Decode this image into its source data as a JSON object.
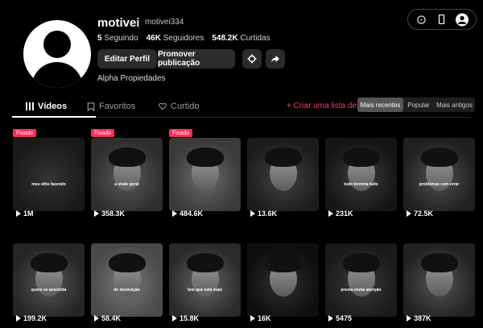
{
  "profile": {
    "username": "motivei",
    "handle": "motivei334",
    "stats": [
      {
        "value": "5",
        "label": "Seguindo"
      },
      {
        "value": "46K",
        "label": "Seguidores"
      },
      {
        "value": "548.2K",
        "label": "Curtidas"
      }
    ],
    "edit_label": "Editar Perfil",
    "promote_label": "Promover publicação",
    "bio": "Alpha Propiedades"
  },
  "tabs": [
    {
      "label": "Vídeos",
      "icon": "grid-icon",
      "active": true
    },
    {
      "label": "Favoritos",
      "icon": "bookmark-icon",
      "active": false
    },
    {
      "label": "Curtido",
      "icon": "heart-icon",
      "active": false
    }
  ],
  "create_list_label": "Criar uma lista de reprodução",
  "sort_options": [
    "Mais recentes",
    "Popular",
    "Mais antigos"
  ],
  "sort_selected": "Mais recentes",
  "pinned_label": "Fixado",
  "videos": [
    {
      "views": "1M",
      "caption": "meu olho fazendo",
      "pinned": true
    },
    {
      "views": "358.3K",
      "caption": "a visão geral",
      "pinned": true
    },
    {
      "views": "484.6K",
      "caption": "",
      "pinned": true
    },
    {
      "views": "13.6K",
      "caption": "",
      "pinned": false
    },
    {
      "views": "231K",
      "caption": "tudo termina tudo",
      "pinned": false
    },
    {
      "views": "72.5K",
      "caption": "problemas com errar",
      "pinned": false
    },
    {
      "views": "199.2K",
      "caption": "quero se assistida",
      "pinned": false
    },
    {
      "views": "58.4K",
      "caption": "de destruição",
      "pinned": false
    },
    {
      "views": "15.8K",
      "caption": "tem que está mais",
      "pinned": false
    },
    {
      "views": "16K",
      "caption": "",
      "pinned": false
    },
    {
      "views": "5475",
      "caption": "presta muita atenção",
      "pinned": false
    },
    {
      "views": "387K",
      "caption": "",
      "pinned": false
    }
  ]
}
